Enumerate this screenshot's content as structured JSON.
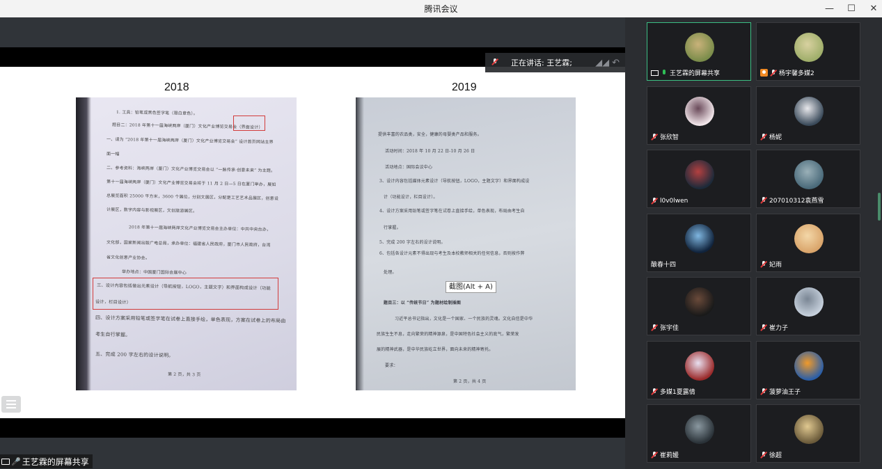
{
  "window": {
    "title": "腾讯会议",
    "controls": {
      "minimize": "—",
      "maximize": "☐",
      "close": "✕"
    }
  },
  "slide": {
    "year_left": "2018",
    "year_right": "2019",
    "left_doc_lines": [
      "1. 工具：铅笔或黑色签字笔（限白章色）。",
      "题目二：2018 年第十一届海峡两岸（厦门）文化产业博览交易会（界面设计）",
      "一、请为 “2018 年第十一届海峡两岸（厦门）文化产业博览交易会” 设计首页网站主界",
      "面一幅",
      "二、参考资料：海峡两岸（厦门）文化产业博览交易会以 “一脉传承·创意未来” 为主题。",
      "第十一届海峡两岸（厦门）文化产业博览交易会将于 11 月 2 日—5 日在厦门举办，展如",
      "总展览面积 25000 平方米，3600 个展位，分别文展区，分配是工艺艺术品展区，创意设",
      "计展区，数字内容与影视展区，文创旅游展区。",
      "2018 年第十一届海峡两岸文化产业博览交易会主办单位：中共中央台办，",
      "文化部，国家新闻出版广电总局，承办单位：福建省人民政府，厦门市人民政府，台湾",
      "省文化创意产业协会。",
      "举办地点：中国厦门国际会展中心",
      "三、设计内容包括做出元素设计（导航按钮，LOGO，主题文字）和界面构成设计（功能",
      "设计，栏目设计）",
      "四、设计方案采用铅笔或签字笔在试卷上直接手绘，单色表现，方案在试卷上的布局由",
      "考生自行掌握。",
      "五、完成 200 字左右的设计说明。",
      "第 2 页，共 3 页"
    ],
    "right_doc_lines": [
      "提供丰富的农品类，安全，健康的母婴类产品和服务。",
      "活动时间：2018 年 10 月 22 日-10 月 26 日",
      "活动地点：国际会议中心",
      "3、设计内容包括媒体元素设计（导航按钮，LOGO，主题文字）和界面构成设",
      "计（功能设计，栏目设计）。",
      "4、设计方案采用铅笔或签字笔在试卷上直接手绘，单色表现，布局由考生自",
      "行掌握。",
      "5、完成 200 字左右的设计说明。",
      "6、包括各设计元素不得出现与考生及本校教师相关的任何信息，否则按作弊",
      "处理。",
      "题目三：以 “传统节日” 为题材绘制插图",
      "习近平总书记指出，文化是一个国家、一个民族的灵魂。文化自信是中华",
      "民族生生不息，走向繁荣的精神源泉，是中国特色社会主义的底气，繁荣发",
      "展的精神武器，是中华民族屹立世界，面向未来的精神寄托。",
      "要求：",
      "第 2 页，共 4 页"
    ]
  },
  "speaking": {
    "label": "正在讲话: 王艺霖;"
  },
  "tooltip": {
    "text": "截图(Alt + A)"
  },
  "share_label": {
    "text": "王艺霖的屏幕共享"
  },
  "participants": [
    {
      "name": "王艺霖的屏幕共享",
      "status": "screen-share",
      "avatar_colors": [
        "#7a8c4a",
        "#c9b27a"
      ]
    },
    {
      "name": "杨宇馨多媒2",
      "status": "muted",
      "avatar_colors": [
        "#9fae6a",
        "#d8d1a0"
      ]
    },
    {
      "name": "张欣智",
      "status": "muted",
      "avatar_colors": [
        "#f1e6ea",
        "#6a4a5a"
      ]
    },
    {
      "name": "杨妮",
      "status": "muted",
      "avatar_colors": [
        "#3a4a5a",
        "#e8e8ec"
      ]
    },
    {
      "name": "l0v0lwen",
      "status": "muted",
      "avatar_colors": [
        "#1c2a3a",
        "#b34040"
      ]
    },
    {
      "name": "207010312袁燕雪",
      "status": "muted",
      "avatar_colors": [
        "#4a6a7a",
        "#9ab0b8"
      ]
    },
    {
      "name": "酿春十四",
      "status": "none",
      "avatar_colors": [
        "#10233c",
        "#7fb6e0"
      ]
    },
    {
      "name": "妃雨",
      "status": "muted",
      "avatar_colors": [
        "#d9a46a",
        "#f3d7a8"
      ]
    },
    {
      "name": "张宇佳",
      "status": "muted",
      "avatar_colors": [
        "#1a1a1a",
        "#6a4a3a"
      ]
    },
    {
      "name": "崔力子",
      "status": "muted",
      "avatar_colors": [
        "#c6d0dc",
        "#7a8694"
      ]
    },
    {
      "name": "多媒1夏露倩",
      "status": "muted",
      "avatar_colors": [
        "#9a2a2a",
        "#e8e0f0"
      ]
    },
    {
      "name": "菠萝油王子",
      "status": "muted",
      "avatar_colors": [
        "#2a5ea8",
        "#f09a2a"
      ]
    },
    {
      "name": "崔莉媛",
      "status": "muted",
      "avatar_colors": [
        "#2a3238",
        "#8a98a0"
      ]
    },
    {
      "name": "徐超",
      "status": "muted",
      "avatar_colors": [
        "#6a5a3a",
        "#e0c890"
      ]
    }
  ]
}
